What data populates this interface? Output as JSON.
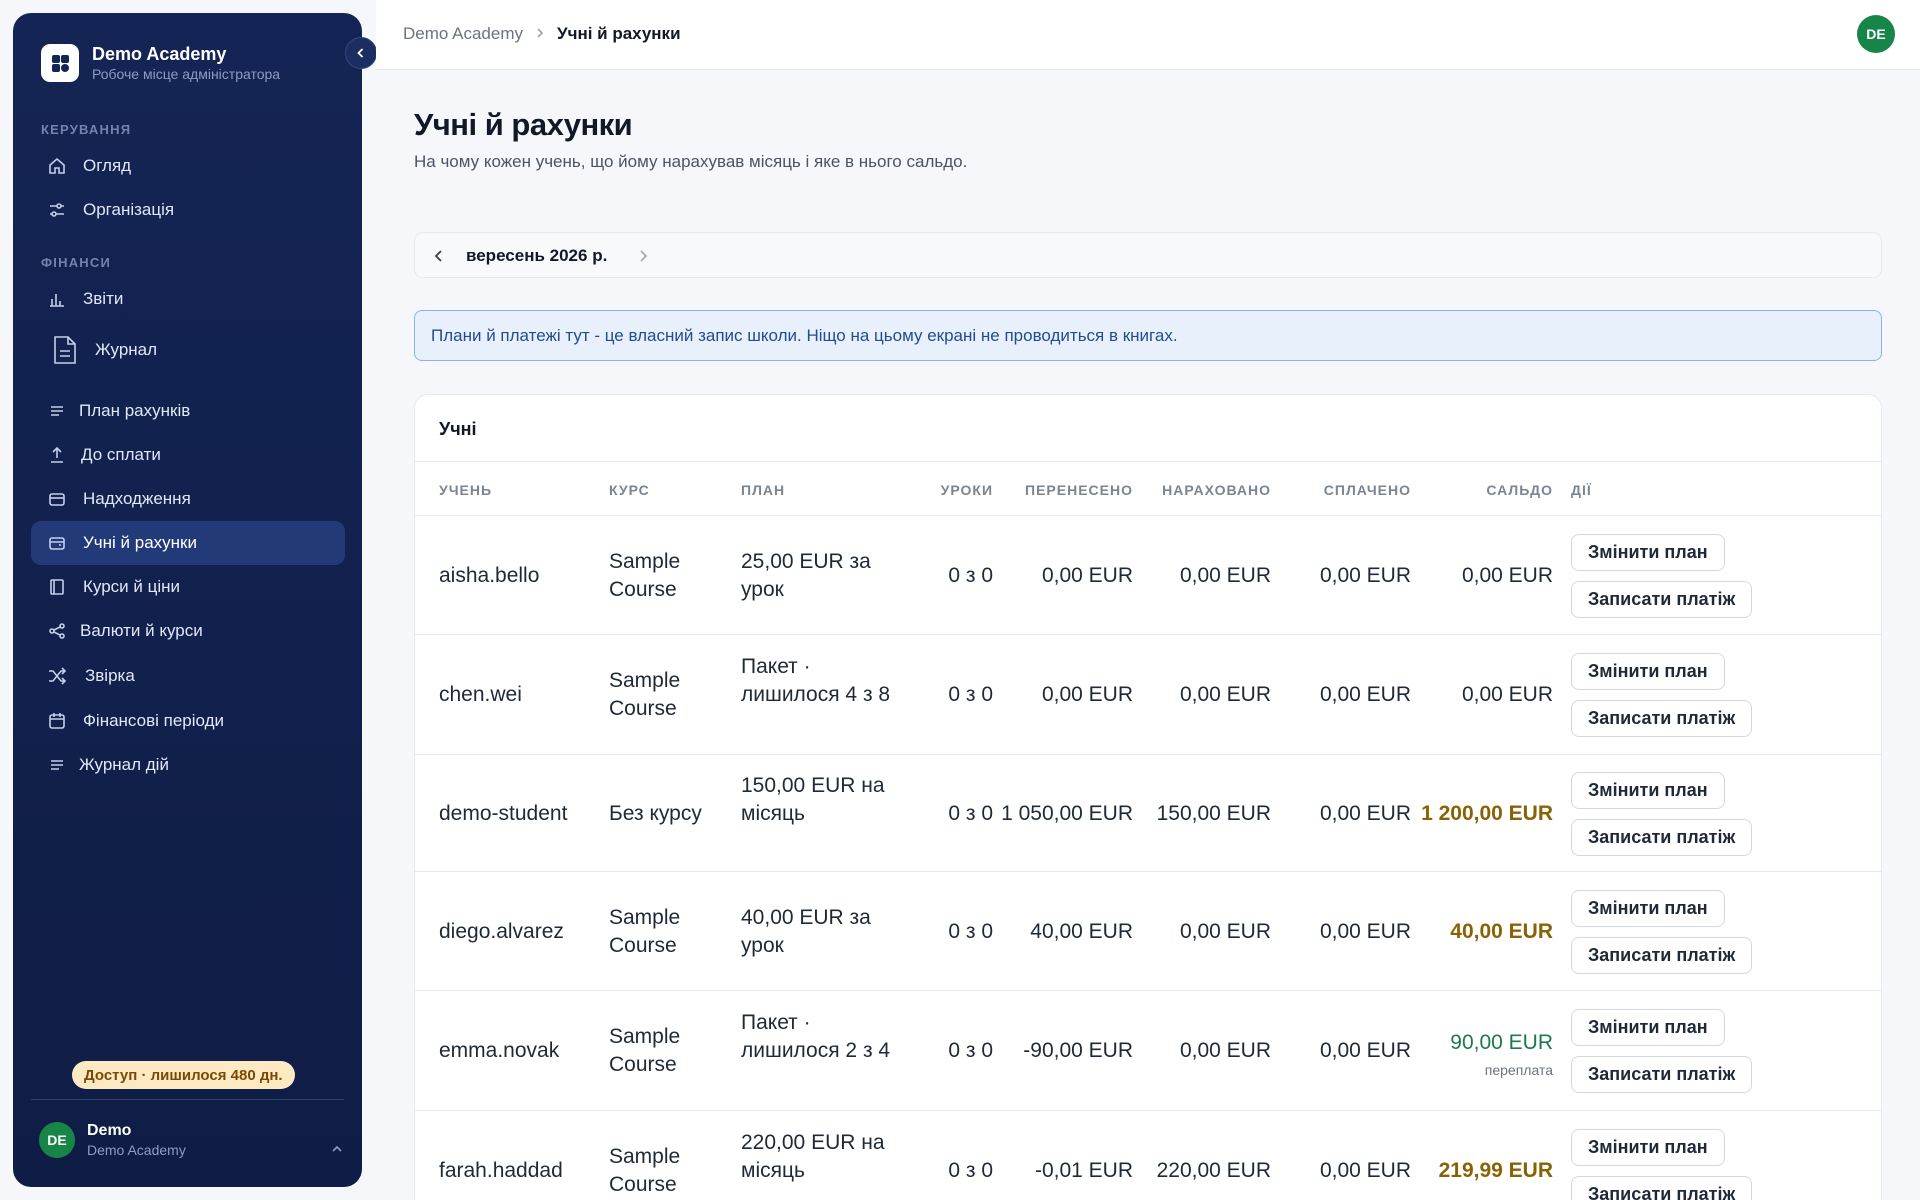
{
  "sidebar": {
    "brand_name": "Demo Academy",
    "brand_sub": "Робоче місце адміністратора",
    "section_manage": "КЕРУВАННЯ",
    "section_finance": "ФІНАНСИ",
    "items": [
      {
        "label": "Огляд",
        "icon": "home-icon"
      },
      {
        "label": "Організація",
        "icon": "sliders-icon"
      },
      {
        "label": "Звіти",
        "icon": "bar-chart-icon"
      },
      {
        "label": "Журнал",
        "icon": "document-icon"
      },
      {
        "label": "План рахунків",
        "icon": "list-icon"
      },
      {
        "label": "До сплати",
        "icon": "upload-icon"
      },
      {
        "label": "Надходження",
        "icon": "wallet-icon"
      },
      {
        "label": "Учні й рахунки",
        "icon": "card-icon"
      },
      {
        "label": "Курси й ціни",
        "icon": "book-icon"
      },
      {
        "label": "Валюти й курси",
        "icon": "share-icon"
      },
      {
        "label": "Звірка",
        "icon": "shuffle-icon"
      },
      {
        "label": "Фінансові періоди",
        "icon": "calendar-icon"
      },
      {
        "label": "Журнал дій",
        "icon": "list-icon"
      }
    ],
    "access_badge": "Доступ · лишилося 480 дн.",
    "user_initials": "DE",
    "user_name": "Demo",
    "user_org": "Demo Academy"
  },
  "topbar": {
    "crumb_root": "Demo Academy",
    "crumb_current": "Учні й рахунки",
    "avatar_initials": "DE"
  },
  "main": {
    "title": "Учні й рахунки",
    "subtitle": "На чому кожен учень, що йому нарахував місяць і яке в нього сальдо.",
    "month": "вересень 2026 р.",
    "notice": "Плани й платежі тут - це власний запис школи. Ніщо на цьому екрані не проводиться в книгах."
  },
  "table": {
    "title": "Учні",
    "headers": {
      "student": "УЧЕНЬ",
      "course": "КУРС",
      "plan": "ПЛАН",
      "lessons": "УРОКИ",
      "carried": "ПЕРЕНЕСЕНО",
      "charged": "НАРАХОВАНО",
      "paid": "СПЛАЧЕНО",
      "balance": "САЛЬДО",
      "actions": "ДІЇ"
    },
    "action_change": "Змінити план",
    "action_record": "Записати платіж",
    "rows": [
      {
        "student": "aisha.bello",
        "course": "Sample Course",
        "plan": "25,00 EUR за урок",
        "lessons": "0 з 0",
        "carried": "0,00 EUR",
        "charged": "0,00 EUR",
        "paid": "0,00 EUR",
        "balance": "0,00 EUR",
        "balance_note": "",
        "status": "neutral"
      },
      {
        "student": "chen.wei",
        "course": "Sample Course",
        "plan": "Пакет · лишилося 4 з 8",
        "lessons": "0 з 0",
        "carried": "0,00 EUR",
        "charged": "0,00 EUR",
        "paid": "0,00 EUR",
        "balance": "0,00 EUR",
        "balance_note": "",
        "status": "neutral"
      },
      {
        "student": "demo-student",
        "course": "Без курсу",
        "plan": "150,00 EUR на місяць",
        "lessons": "0 з 0",
        "carried": "1 050,00 EUR",
        "charged": "150,00 EUR",
        "paid": "0,00 EUR",
        "balance": "1 200,00 EUR",
        "balance_note": "",
        "status": "owed"
      },
      {
        "student": "diego.alvarez",
        "course": "Sample Course",
        "plan": "40,00 EUR за урок",
        "lessons": "0 з 0",
        "carried": "40,00 EUR",
        "charged": "0,00 EUR",
        "paid": "0,00 EUR",
        "balance": "40,00 EUR",
        "balance_note": "",
        "status": "owed"
      },
      {
        "student": "emma.novak",
        "course": "Sample Course",
        "plan": "Пакет · лишилося 2 з 4",
        "lessons": "0 з 0",
        "carried": "-90,00 EUR",
        "charged": "0,00 EUR",
        "paid": "0,00 EUR",
        "balance": "90,00 EUR",
        "balance_note": "переплата",
        "status": "credit"
      },
      {
        "student": "farah.haddad",
        "course": "Sample Course",
        "plan": "220,00 EUR на місяць",
        "lessons": "0 з 0",
        "carried": "-0,01 EUR",
        "charged": "220,00 EUR",
        "paid": "0,00 EUR",
        "balance": "219,99 EUR",
        "balance_note": "",
        "status": "owed"
      }
    ]
  },
  "colors": {
    "sidebar_bg": "#142454",
    "active_item": "#233a79",
    "owed": "#8a6206",
    "credit": "#1d7a4d",
    "avatar": "#178548"
  }
}
